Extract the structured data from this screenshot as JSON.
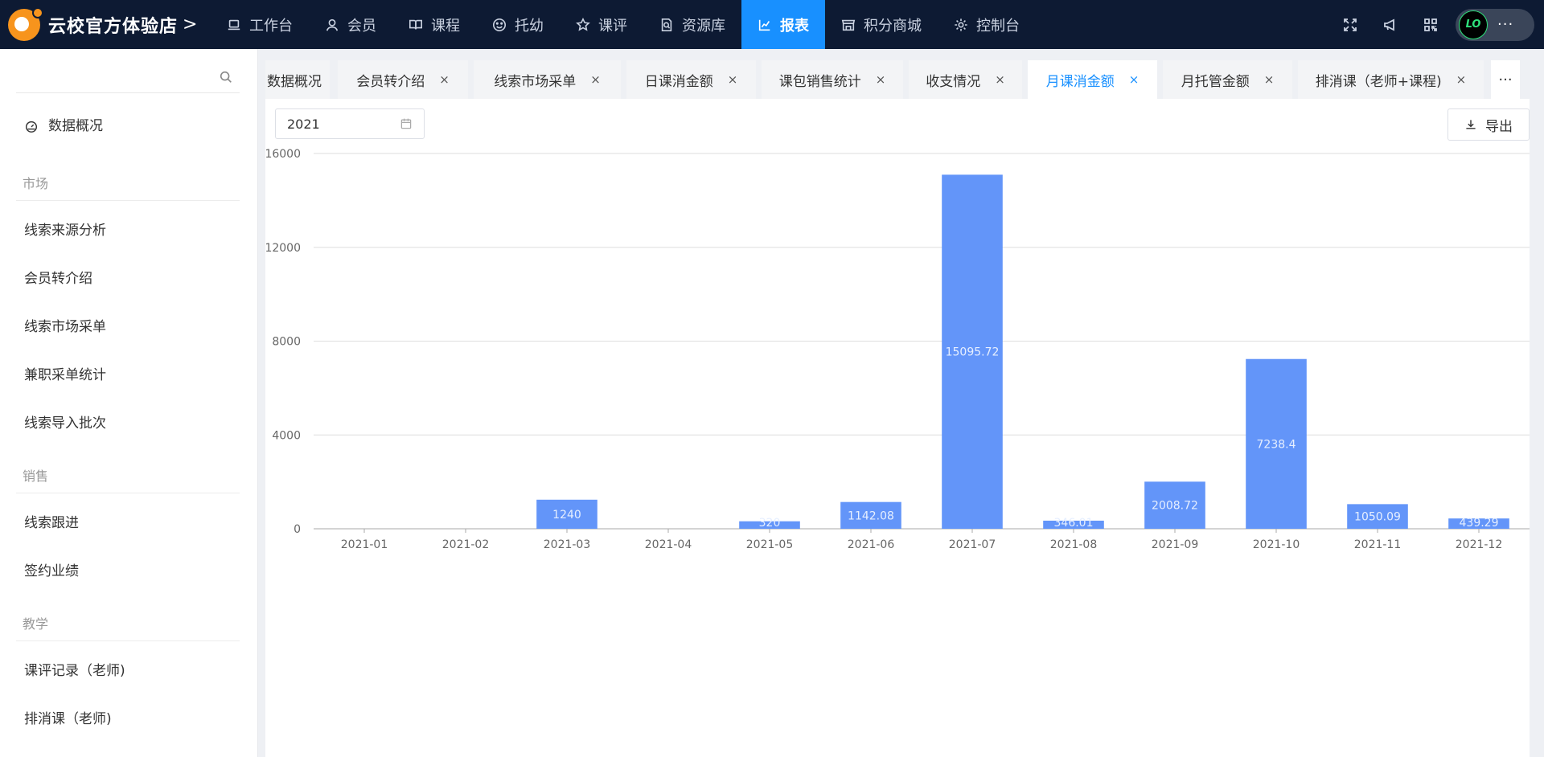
{
  "brand": {
    "title": "云校官方体验店",
    "chevron": ">"
  },
  "nav": [
    {
      "label": "工作台",
      "icon": "laptop-icon"
    },
    {
      "label": "会员",
      "icon": "user-icon"
    },
    {
      "label": "课程",
      "icon": "book-icon"
    },
    {
      "label": "托幼",
      "icon": "smile-icon"
    },
    {
      "label": "课评",
      "icon": "star-icon"
    },
    {
      "label": "资源库",
      "icon": "file-search-icon"
    },
    {
      "label": "报表",
      "icon": "chart-icon",
      "active": true
    },
    {
      "label": "积分商城",
      "icon": "shop-icon"
    },
    {
      "label": "控制台",
      "icon": "gear-icon"
    }
  ],
  "topright": {
    "icons": [
      "fullscreen-icon",
      "announcement-icon",
      "qrcode-icon"
    ],
    "avatar_text": "LO",
    "more": "···"
  },
  "sidebar": {
    "search_placeholder": "",
    "overview": "数据概况",
    "groups": [
      {
        "title": "市场",
        "items": [
          "线索来源分析",
          "会员转介绍",
          "线索市场采单",
          "兼职采单统计",
          "线索导入批次"
        ]
      },
      {
        "title": "销售",
        "items": [
          "线索跟进",
          "签约业绩"
        ]
      },
      {
        "title": "教学",
        "items": [
          "课评记录（老师)",
          "排消课（老师)"
        ]
      }
    ]
  },
  "tabs": [
    {
      "label": "数据概况",
      "closable": false
    },
    {
      "label": "会员转介绍",
      "closable": true
    },
    {
      "label": "线索市场采单",
      "closable": true
    },
    {
      "label": "日课消金额",
      "closable": true
    },
    {
      "label": "课包销售统计",
      "closable": true
    },
    {
      "label": "收支情况",
      "closable": true
    },
    {
      "label": "月课消金额",
      "closable": true,
      "active": true
    },
    {
      "label": "月托管金额",
      "closable": true
    },
    {
      "label": "排消课（老师+课程)",
      "closable": true
    }
  ],
  "tab_close": "×",
  "tab_more": "···",
  "toolbar": {
    "year": "2021",
    "export_label": "导出"
  },
  "colors": {
    "nav_bg": "#0d1a33",
    "accent": "#1890ff",
    "bar": "#6395f9"
  },
  "chart_data": {
    "type": "bar",
    "categories": [
      "2021-01",
      "2021-02",
      "2021-03",
      "2021-04",
      "2021-05",
      "2021-06",
      "2021-07",
      "2021-08",
      "2021-09",
      "2021-10",
      "2021-11",
      "2021-12"
    ],
    "values": [
      0,
      0,
      1240,
      0,
      320,
      1142.08,
      15095.72,
      346.01,
      2008.72,
      7238.4,
      1050.09,
      439.29
    ],
    "labels": [
      "",
      "",
      "1240",
      "",
      "320",
      "1142.08",
      "15095.72",
      "346.01",
      "2008.72",
      "7238.4",
      "1050.09",
      "439.29"
    ],
    "yticks": [
      0,
      4000,
      8000,
      12000,
      16000
    ],
    "ylim": [
      0,
      16000
    ],
    "grid": true
  }
}
